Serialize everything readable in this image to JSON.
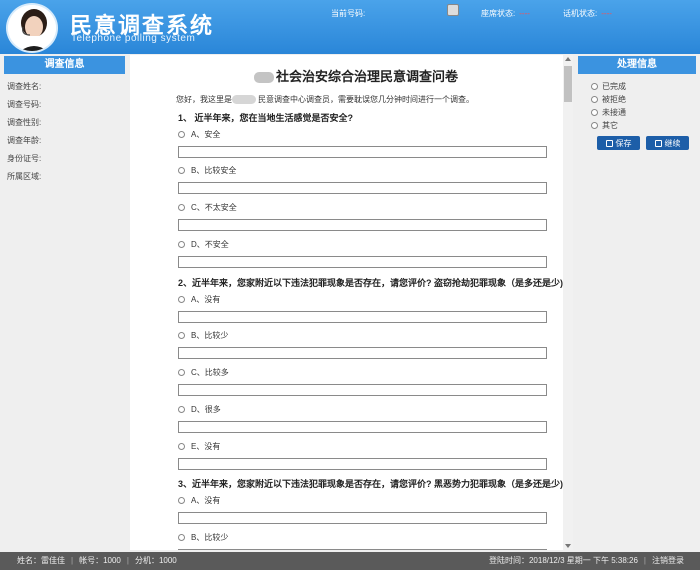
{
  "header": {
    "title": "民意调查系统",
    "subtitle": "Telephone polling system",
    "current_number_label": "当前号码:",
    "seat_status_label": "座席状态:",
    "seat_status_value": "----",
    "phone_status_label": "话机状态:",
    "phone_status_value": "----"
  },
  "left_panel": {
    "title": "调查信息",
    "fields": [
      "调查姓名:",
      "调查号码:",
      "调查性别:",
      "调查年龄:",
      "身份证号:",
      "所属区域:"
    ]
  },
  "right_panel": {
    "title": "处理信息",
    "options": [
      "已完成",
      "被拒绝",
      "未接通",
      "其它"
    ],
    "save_label": "保存",
    "continue_label": "继续"
  },
  "survey": {
    "title": "社会治安综合治理民意调查问卷",
    "intro_prefix": "您好，我这里是",
    "intro_suffix": "民意调查中心调查员，需要耽误您几分钟时间进行一个调查。",
    "questions": [
      {
        "text": "1、  近半年来，您在当地生活感觉是否安全?",
        "options": [
          "A、安全",
          "B、比较安全",
          "C、不太安全",
          "D、不安全"
        ]
      },
      {
        "text": "2、近半年来，您家附近以下违法犯罪现象是否存在，请您评价?   盗窃抢劫犯罪现象（是多还是少)",
        "options": [
          "A、没有",
          "B、比较少",
          "C、比较多",
          "D、很多",
          "E、没有"
        ]
      },
      {
        "text": "3、近半年来，您家附近以下违法犯罪现象是否存在，请您评价?   黑恶势力犯罪现象（是多还是少)",
        "options": [
          "A、没有",
          "B、比较少"
        ]
      }
    ]
  },
  "footer": {
    "name": "姓名：雷佳佳",
    "account": "帐号：1000",
    "extension": "分机：1000",
    "login_time": "登陆时间：2018/12/3 星期一 下午 5:38:26",
    "logout": "注销登录"
  }
}
